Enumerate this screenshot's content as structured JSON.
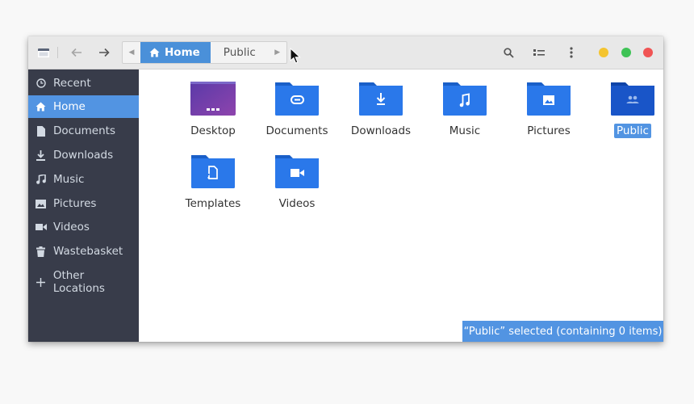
{
  "header": {
    "app_icon": "files-icon",
    "back_icon": "arrow-left-icon",
    "forward_icon": "arrow-right-icon",
    "search_icon": "search-icon",
    "view_icon": "list-view-icon",
    "menu_icon": "kebab-menu-icon",
    "window_controls": {
      "minimize": "#f4c430",
      "maximize": "#3fc356",
      "close": "#f05454"
    }
  },
  "pathbar": {
    "crumbs": [
      {
        "label": "Home",
        "active": true
      },
      {
        "label": "Public",
        "active": false
      }
    ]
  },
  "sidebar": {
    "items": [
      {
        "label": "Recent",
        "icon": "clock-icon"
      },
      {
        "label": "Home",
        "icon": "home-icon",
        "active": true
      },
      {
        "label": "Documents",
        "icon": "document-icon"
      },
      {
        "label": "Downloads",
        "icon": "download-icon"
      },
      {
        "label": "Music",
        "icon": "music-icon"
      },
      {
        "label": "Pictures",
        "icon": "picture-icon"
      },
      {
        "label": "Videos",
        "icon": "video-icon"
      },
      {
        "label": "Wastebasket",
        "icon": "trash-icon"
      },
      {
        "label": "Other Locations",
        "icon": "plus-icon"
      }
    ]
  },
  "folders": [
    {
      "label": "Desktop",
      "icon": "desktop-folder-icon"
    },
    {
      "label": "Documents",
      "icon": "paperclip-folder-icon"
    },
    {
      "label": "Downloads",
      "icon": "download-folder-icon"
    },
    {
      "label": "Music",
      "icon": "music-folder-icon"
    },
    {
      "label": "Pictures",
      "icon": "picture-folder-icon"
    },
    {
      "label": "Public",
      "icon": "people-folder-icon",
      "selected": true
    },
    {
      "label": "Templates",
      "icon": "template-folder-icon"
    },
    {
      "label": "Videos",
      "icon": "video-folder-icon"
    }
  ],
  "status": {
    "text": "“Public” selected  (containing 0 items)"
  },
  "colors": {
    "accent": "#5294e2",
    "sidebar_bg": "#383c4a",
    "folder_blue": "#1e6fe0"
  }
}
